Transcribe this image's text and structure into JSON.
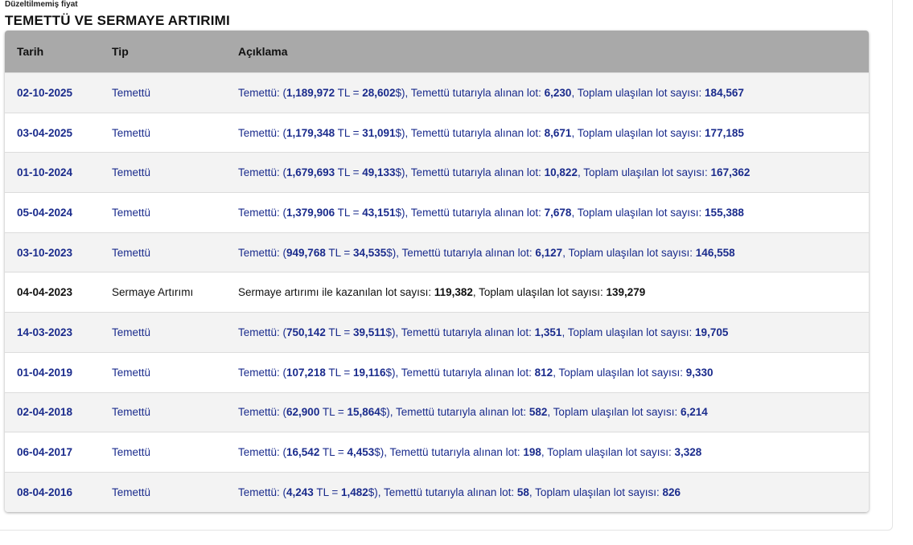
{
  "subtitle": "Düzeltilmemiş fiyat",
  "title": "TEMETTÜ VE SERMAYE ARTIRIMI",
  "columns": {
    "date": "Tarih",
    "type": "Tip",
    "desc": "Açıklama"
  },
  "text": {
    "div_prefix": "Temettü: (",
    "tl_eq": " TL = ",
    "div_mid": "$), Temettü tutarıyla alınan lot: ",
    "cap_prefix": "Sermaye artırımı ile kazanılan lot sayısı: ",
    "total": ", Toplam ulaşılan lot sayısı: "
  },
  "rows": [
    {
      "date": "02-10-2025",
      "type": "Temettü",
      "kind": "div",
      "tl": "1,189,972",
      "usd": "28,602",
      "lot": "6,230",
      "total": "184,567"
    },
    {
      "date": "03-04-2025",
      "type": "Temettü",
      "kind": "div",
      "tl": "1,179,348",
      "usd": "31,091",
      "lot": "8,671",
      "total": "177,185"
    },
    {
      "date": "01-10-2024",
      "type": "Temettü",
      "kind": "div",
      "tl": "1,679,693",
      "usd": "49,133",
      "lot": "10,822",
      "total": "167,362"
    },
    {
      "date": "05-04-2024",
      "type": "Temettü",
      "kind": "div",
      "tl": "1,379,906",
      "usd": "43,151",
      "lot": "7,678",
      "total": "155,388"
    },
    {
      "date": "03-10-2023",
      "type": "Temettü",
      "kind": "div",
      "tl": "949,768",
      "usd": "34,535",
      "lot": "6,127",
      "total": "146,558"
    },
    {
      "date": "04-04-2023",
      "type": "Sermaye Artırımı",
      "kind": "cap",
      "lot": "119,382",
      "total": "139,279"
    },
    {
      "date": "14-03-2023",
      "type": "Temettü",
      "kind": "div",
      "tl": "750,142",
      "usd": "39,511",
      "lot": "1,351",
      "total": "19,705"
    },
    {
      "date": "01-04-2019",
      "type": "Temettü",
      "kind": "div",
      "tl": "107,218",
      "usd": "19,116",
      "lot": "812",
      "total": "9,330"
    },
    {
      "date": "02-04-2018",
      "type": "Temettü",
      "kind": "div",
      "tl": "62,900",
      "usd": "15,864",
      "lot": "582",
      "total": "6,214"
    },
    {
      "date": "06-04-2017",
      "type": "Temettü",
      "kind": "div",
      "tl": "16,542",
      "usd": "4,453",
      "lot": "198",
      "total": "3,328"
    },
    {
      "date": "08-04-2016",
      "type": "Temettü",
      "kind": "div",
      "tl": "4,243",
      "usd": "1,482",
      "lot": "58",
      "total": "826"
    }
  ],
  "colors": {
    "header_bg": "#a9a9a9",
    "dividend_text": "#1a2b8c",
    "capital_text": "#111111"
  }
}
